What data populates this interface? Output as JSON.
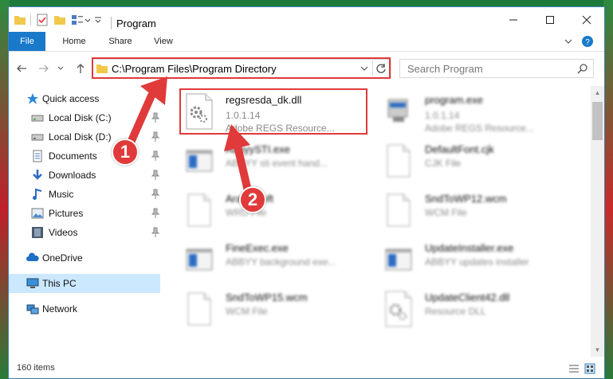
{
  "window": {
    "title": "Program"
  },
  "ribbon": {
    "tabs": [
      "File",
      "Home",
      "Share",
      "View"
    ]
  },
  "address": {
    "path": "C:\\Program Files\\Program Directory",
    "search_placeholder": "Search Program"
  },
  "sidebar": {
    "items": [
      {
        "label": "Quick access",
        "icon": "star-icon"
      },
      {
        "label": "Local Disk (C:)",
        "icon": "drive-icon",
        "pinned": true
      },
      {
        "label": "Local Disk (D:)",
        "icon": "drive-icon",
        "pinned": true
      },
      {
        "label": "Documents",
        "icon": "documents-icon",
        "pinned": true
      },
      {
        "label": "Downloads",
        "icon": "download-icon",
        "pinned": true
      },
      {
        "label": "Music",
        "icon": "music-icon",
        "pinned": true
      },
      {
        "label": "Pictures",
        "icon": "pictures-icon",
        "pinned": true
      },
      {
        "label": "Videos",
        "icon": "videos-icon",
        "pinned": true
      },
      {
        "label": "OneDrive",
        "icon": "cloud-icon"
      },
      {
        "label": "This PC",
        "icon": "computer-icon",
        "selected": true
      },
      {
        "label": "Network",
        "icon": "network-icon"
      }
    ]
  },
  "files": [
    {
      "name": "regsresda_dk.dll",
      "line2": "1.0.1.14",
      "line3": "Adobe REGS Resource...",
      "icon": "dll-gear-icon"
    },
    {
      "name": "program.exe",
      "line2": "1.0.1.14",
      "line3": "Adobe REGS Resource...",
      "icon": "exe-icon"
    },
    {
      "name": "AbbyySTI.exe",
      "line2": "ABBYY sti event hand...",
      "icon": "window-app-icon"
    },
    {
      "name": "DefaultFont.cjk",
      "line2": "CJK File",
      "icon": "blank-file-icon"
    },
    {
      "name": "ArabicSoft",
      "line2": "WRD File",
      "icon": "blank-file-icon"
    },
    {
      "name": "SndToWP12.wcm",
      "line2": "WCM File",
      "icon": "blank-file-icon"
    },
    {
      "name": "FineExec.exe",
      "line2": "ABBYY background exe...",
      "icon": "window-app-icon"
    },
    {
      "name": "UpdateInstaller.exe",
      "line2": "ABBYY updates installer",
      "icon": "window-app-icon"
    },
    {
      "name": "SndToWP15.wcm",
      "line2": "WCM File",
      "icon": "blank-file-icon"
    },
    {
      "name": "UpdateClient42.dll",
      "line2": "Resource DLL",
      "icon": "dll-gear-icon"
    }
  ],
  "status": {
    "item_count": "160 items"
  },
  "annotations": {
    "step1": "1",
    "step2": "2",
    "highlight_color": "#e03a3a"
  },
  "colors": {
    "accent": "#1979ca",
    "selected": "#cce8ff"
  }
}
